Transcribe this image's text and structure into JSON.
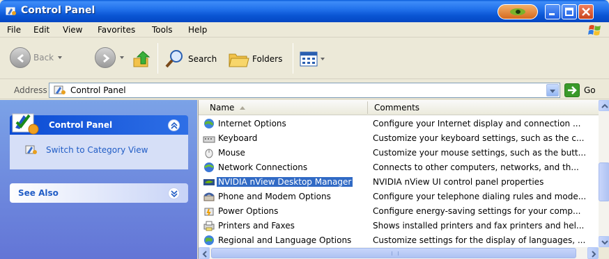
{
  "window": {
    "title": "Control Panel"
  },
  "menu": [
    "File",
    "Edit",
    "View",
    "Favorites",
    "Tools",
    "Help"
  ],
  "toolbar": {
    "back_label": "Back",
    "search_label": "Search",
    "folders_label": "Folders"
  },
  "address": {
    "label": "Address",
    "value": "Control Panel",
    "go_label": "Go"
  },
  "taskpane": {
    "control_panel_title": "Control Panel",
    "switch_link": "Switch to Category View",
    "see_also_title": "See Also"
  },
  "list": {
    "columns": [
      "Name",
      "Comments"
    ],
    "rows": [
      {
        "name": "Internet Options",
        "comment": "Configure your Internet display and connection ...",
        "icon": "internet-options-icon"
      },
      {
        "name": "Keyboard",
        "comment": "Customize your keyboard settings, such as the c...",
        "icon": "keyboard-icon"
      },
      {
        "name": "Mouse",
        "comment": "Customize your mouse settings, such as the butt...",
        "icon": "mouse-icon"
      },
      {
        "name": "Network Connections",
        "comment": "Connects to other computers, networks, and th...",
        "icon": "network-connections-icon"
      },
      {
        "name": "NVIDIA nView Desktop Manager",
        "comment": "NVIDIA nView UI control panel properties",
        "icon": "nvidia-icon",
        "selected": true
      },
      {
        "name": "Phone and Modem Options",
        "comment": "Configure your telephone dialing rules and mode...",
        "icon": "phone-modem-icon"
      },
      {
        "name": "Power Options",
        "comment": "Configure energy-saving settings for your comp...",
        "icon": "power-options-icon"
      },
      {
        "name": "Printers and Faxes",
        "comment": "Shows installed printers and fax printers and hel...",
        "icon": "printers-faxes-icon"
      },
      {
        "name": "Regional and Language Options",
        "comment": "Customize settings for the display of languages, ...",
        "icon": "regional-language-icon"
      }
    ]
  },
  "colors": {
    "title_blue": "#0a55d4",
    "selection": "#316ac5",
    "link": "#215dc6",
    "taskpane": "#7ba2e7"
  }
}
